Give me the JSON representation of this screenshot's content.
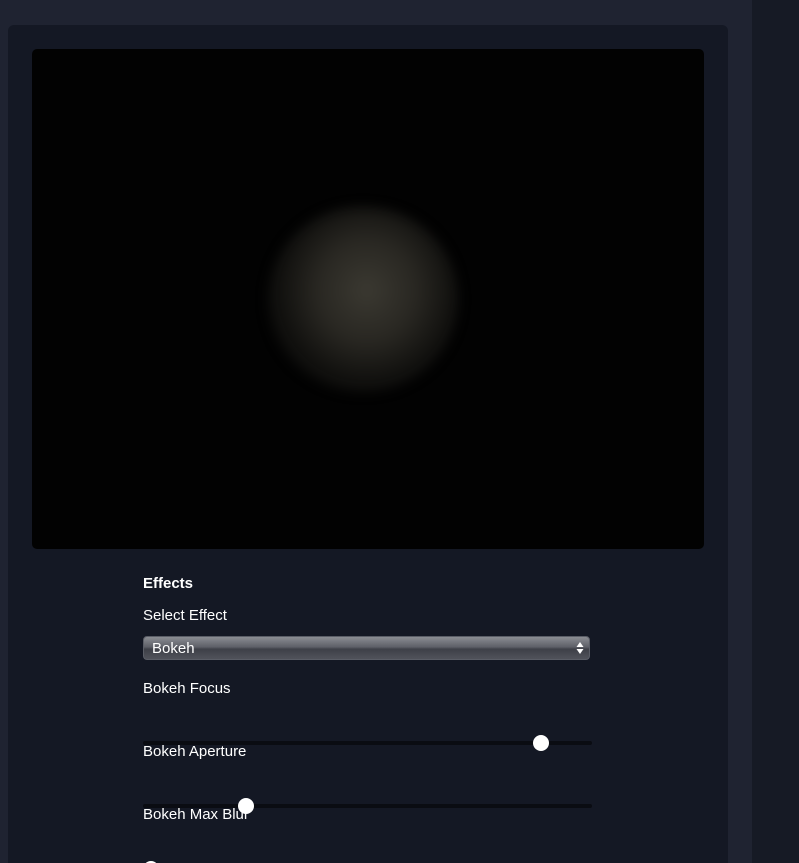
{
  "effects": {
    "section_title": "Effects",
    "select_label": "Select Effect",
    "selected_effect": "Bokeh"
  },
  "sliders": [
    {
      "label": "Bokeh Focus",
      "fraction": 0.9
    },
    {
      "label": "Bokeh Aperture",
      "fraction": 0.22
    },
    {
      "label": "Bokeh Max Blur",
      "fraction": 0.0
    }
  ],
  "icons": {
    "select_arrows": "updown-chevron-icon"
  },
  "colors": {
    "background": "#1f2331",
    "card": "#141824",
    "viewport": "#020202",
    "text": "#ffffff"
  }
}
